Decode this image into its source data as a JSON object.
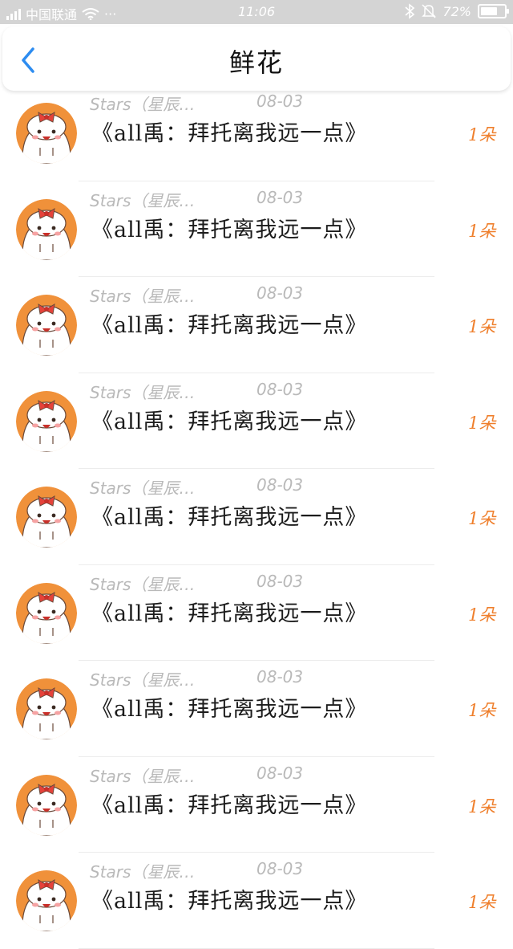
{
  "status_bar": {
    "carrier": "中国联通",
    "dots": "···",
    "time": "11:06",
    "battery": "72%",
    "battery_level": 0.72
  },
  "nav": {
    "title": "鲜花",
    "back_icon": "chevron-left-icon"
  },
  "colors": {
    "accent_blue": "#2d8cf0",
    "count_orange": "#ef7f2c",
    "avatar_orange": "#f0913a",
    "meta_gray": "#b9b9b9"
  },
  "items": [
    {
      "sender": "Stars（星辰…",
      "date": "08-03",
      "title": "《all禹：拜托离我远一点》",
      "count": "1朵"
    },
    {
      "sender": "Stars（星辰…",
      "date": "08-03",
      "title": "《all禹：拜托离我远一点》",
      "count": "1朵"
    },
    {
      "sender": "Stars（星辰…",
      "date": "08-03",
      "title": "《all禹：拜托离我远一点》",
      "count": "1朵"
    },
    {
      "sender": "Stars（星辰…",
      "date": "08-03",
      "title": "《all禹：拜托离我远一点》",
      "count": "1朵"
    },
    {
      "sender": "Stars（星辰…",
      "date": "08-03",
      "title": "《all禹：拜托离我远一点》",
      "count": "1朵"
    },
    {
      "sender": "Stars（星辰…",
      "date": "08-03",
      "title": "《all禹：拜托离我远一点》",
      "count": "1朵"
    },
    {
      "sender": "Stars（星辰…",
      "date": "08-03",
      "title": "《all禹：拜托离我远一点》",
      "count": "1朵"
    },
    {
      "sender": "Stars（星辰…",
      "date": "08-03",
      "title": "《all禹：拜托离我远一点》",
      "count": "1朵"
    },
    {
      "sender": "Stars（星辰…",
      "date": "08-03",
      "title": "《all禹：拜托离我远一点》",
      "count": "1朵"
    }
  ]
}
